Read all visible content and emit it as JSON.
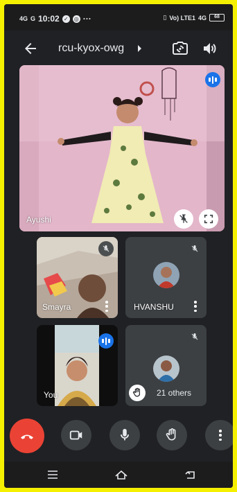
{
  "status_bar": {
    "signal1": "4G",
    "signal2": "G",
    "time": "10:02",
    "dots": "···",
    "volte": "Vo) LTE1",
    "net": "4G",
    "battery": "68"
  },
  "header": {
    "meeting_code": "rcu-kyox-owg"
  },
  "main_tile": {
    "name": "Ayushi"
  },
  "tiles": [
    {
      "name": "Smayra"
    },
    {
      "name": "HVANSHU"
    },
    {
      "name": "You"
    }
  ],
  "others": {
    "label": "21 others"
  },
  "colors": {
    "end_call": "#ea4335",
    "speaking": "#1a73e8",
    "background": "#202124",
    "frame": "#f5f000"
  },
  "icons": [
    "back-arrow-icon",
    "switch-camera-icon",
    "speaker-icon",
    "speaking-indicator-icon",
    "pin-off-icon",
    "fullscreen-icon",
    "mic-off-icon",
    "more-vert-icon",
    "raise-hand-icon",
    "end-call-icon",
    "camera-icon",
    "mic-icon"
  ]
}
